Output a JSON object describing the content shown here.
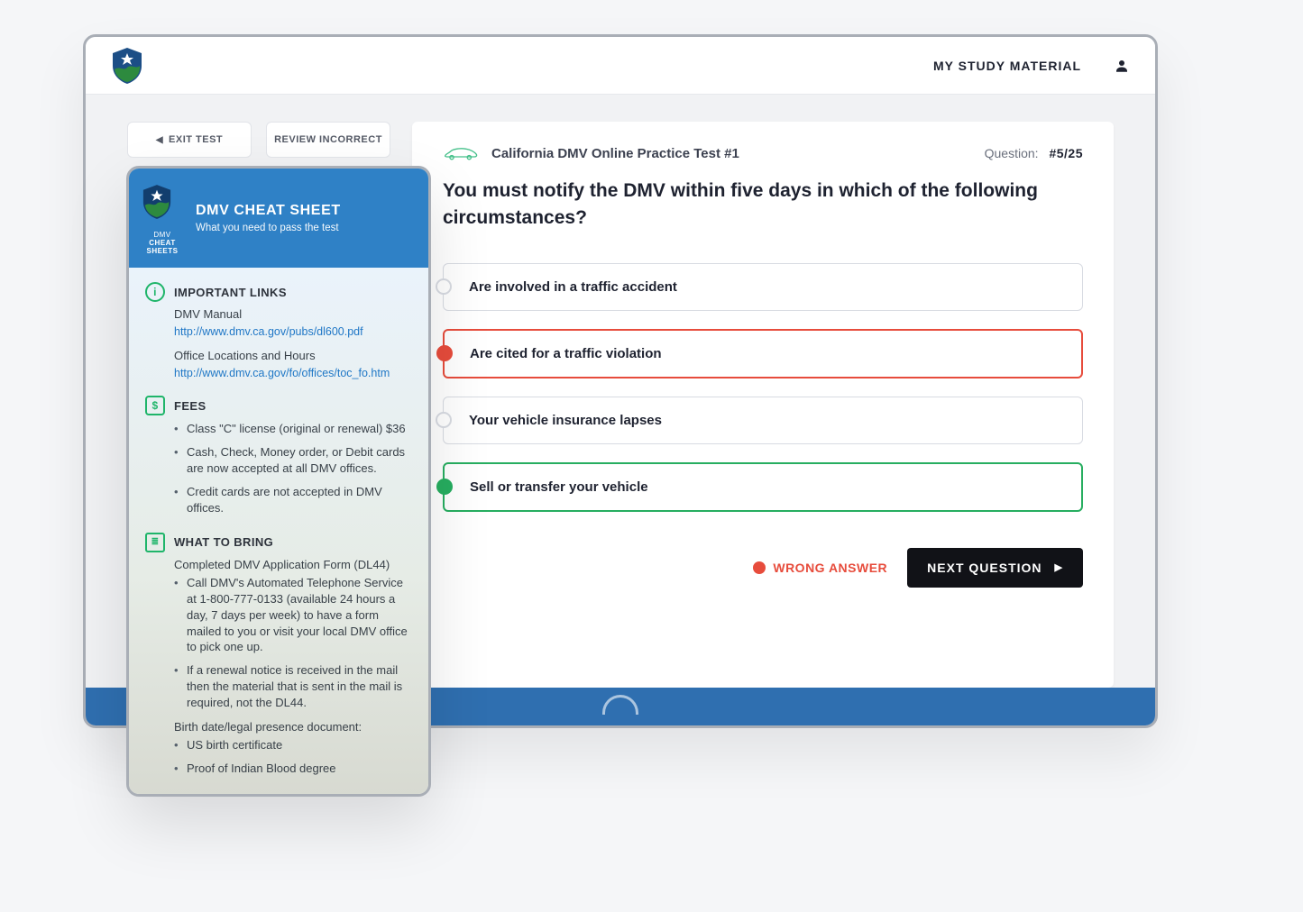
{
  "colors": {
    "accent_blue": "#2f81c6",
    "accent_green": "#27ae60",
    "accent_red": "#e74c3c",
    "footer_blue": "#2f6fb0",
    "text_dark": "#1e2230"
  },
  "header": {
    "nav_link": "MY STUDY MATERIAL"
  },
  "left_panel": {
    "exit_test_label": "EXIT TEST",
    "review_incorrect_label": "REVIEW INCORRECT"
  },
  "quiz": {
    "test_name": "California DMV Online Practice Test #1",
    "counter_label": "Question:",
    "counter_value": "#5/25",
    "question": "You must notify the DMV within five days in which of the following circumstances?",
    "answers": [
      {
        "text": "Are involved in a traffic accident",
        "state": "neutral"
      },
      {
        "text": "Are cited for a traffic violation",
        "state": "wrong"
      },
      {
        "text": "Your vehicle insurance lapses",
        "state": "neutral"
      },
      {
        "text": "Sell or transfer your vehicle",
        "state": "correct"
      }
    ],
    "result_label": "WRONG ANSWER",
    "next_label": "NEXT QUESTION"
  },
  "cheat_sheet": {
    "brand_small": "DMV CHEAT SHEETS",
    "title": "DMV CHEAT SHEET",
    "subtitle": "What you need to pass the test",
    "sections": {
      "links": {
        "heading": "IMPORTANT LINKS",
        "items": [
          {
            "label": "DMV Manual",
            "url": "http://www.dmv.ca.gov/pubs/dl600.pdf"
          },
          {
            "label": "Office Locations and Hours",
            "url": "http://www.dmv.ca.gov/fo/offices/toc_fo.htm"
          }
        ]
      },
      "fees": {
        "heading": "FEES",
        "bullets": [
          "Class \"C\" license (original or renewal) $36",
          "Cash, Check, Money order, or Debit cards are now accepted at all DMV offices.",
          "Credit cards are not accepted in DMV offices."
        ]
      },
      "bring": {
        "heading": "WHAT TO BRING",
        "intro": "Completed DMV Application Form (DL44)",
        "bullets": [
          "Call DMV's Automated Telephone Service at 1-800-777-0133 (available 24 hours a day, 7 days per week) to have a form mailed to you or visit your local DMV office to pick one up.",
          "If a renewal notice is received in the mail then the material that is sent in the mail is required, not the DL44."
        ],
        "sub_intro": "Birth date/legal presence document:",
        "sub_bullets": [
          "US birth certificate",
          "Proof of Indian Blood degree"
        ]
      }
    }
  }
}
